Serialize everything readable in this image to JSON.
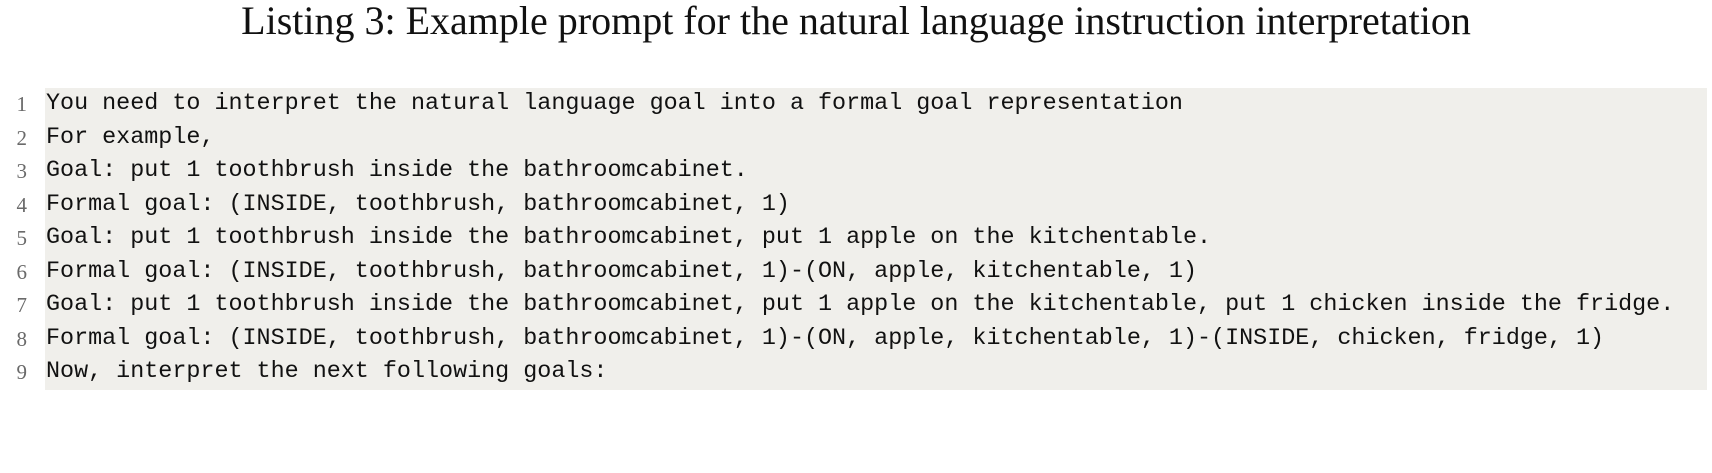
{
  "caption": "Listing 3: Example prompt for the natural language instruction interpretation",
  "listing": {
    "lines": [
      {
        "number": "1",
        "text": "You need to interpret the natural language goal into a formal goal representation"
      },
      {
        "number": "2",
        "text": "For example,"
      },
      {
        "number": "3",
        "text": "Goal: put 1 toothbrush inside the bathroomcabinet."
      },
      {
        "number": "4",
        "text": "Formal goal: (INSIDE, toothbrush, bathroomcabinet, 1)"
      },
      {
        "number": "5",
        "text": "Goal: put 1 toothbrush inside the bathroomcabinet, put 1 apple on the kitchentable."
      },
      {
        "number": "6",
        "text": "Formal goal: (INSIDE, toothbrush, bathroomcabinet, 1)-(ON, apple, kitchentable, 1)"
      },
      {
        "number": "7",
        "text": "Goal: put 1 toothbrush inside the bathroomcabinet, put 1 apple on the kitchentable, put 1 chicken inside the fridge."
      },
      {
        "number": "8",
        "text": "Formal goal: (INSIDE, toothbrush, bathroomcabinet, 1)-(ON, apple, kitchentable, 1)-(INSIDE, chicken, fridge, 1)"
      },
      {
        "number": "9",
        "text": "Now, interpret the next following goals:"
      }
    ]
  }
}
